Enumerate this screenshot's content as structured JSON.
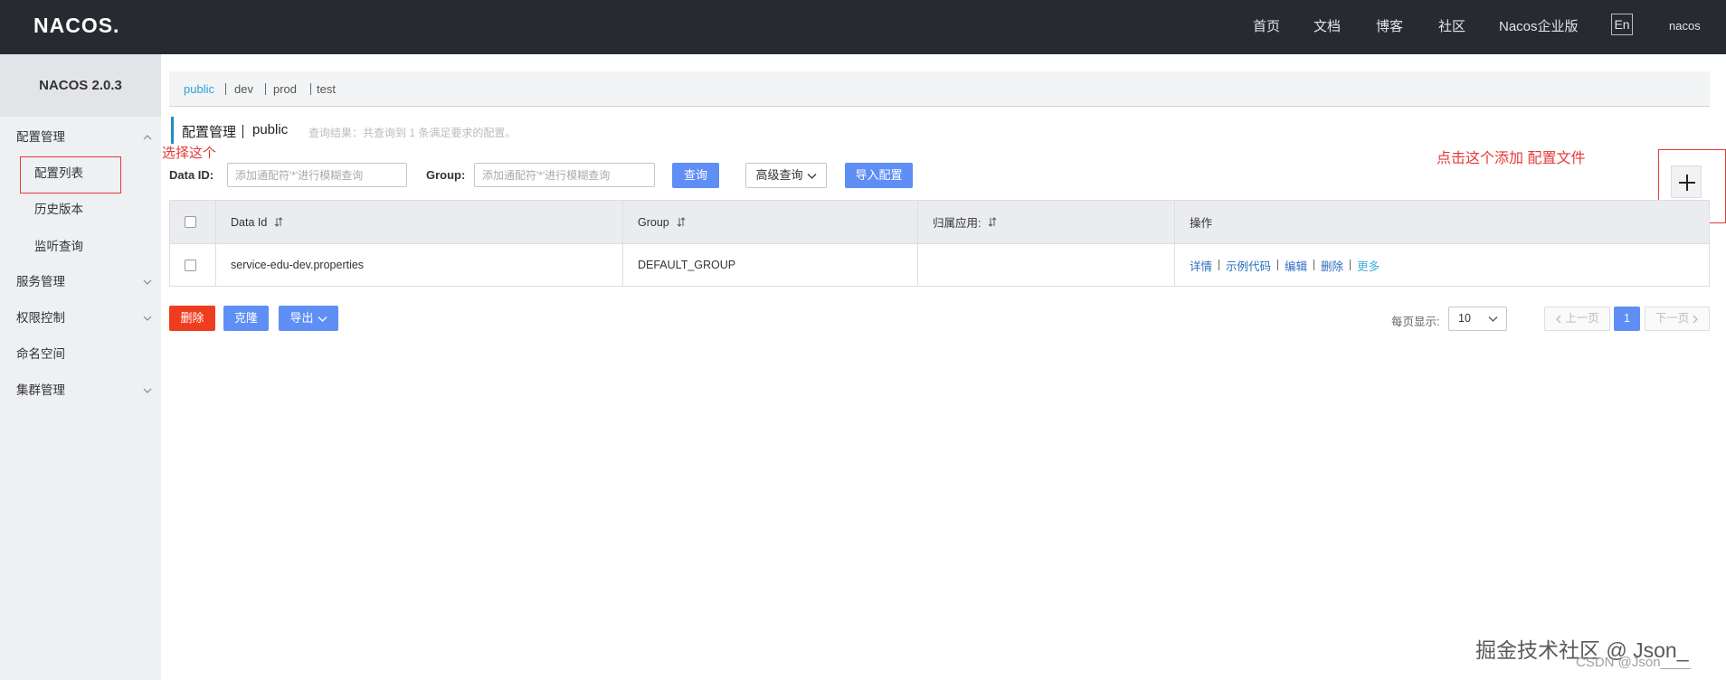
{
  "theme": {
    "accent": "#5f8ef5",
    "danger": "#f03c1e",
    "link": "#2a6ebe",
    "link_more": "#3fb0e0",
    "annotation": "#e53935",
    "namespace_active": "#2aa3d1",
    "header_bg": "#272b31"
  },
  "header": {
    "logo": "NACOS.",
    "nav": [
      {
        "label": "首页"
      },
      {
        "label": "文档"
      },
      {
        "label": "博客"
      },
      {
        "label": "社区"
      },
      {
        "label": "Nacos企业版"
      }
    ],
    "lang": "En",
    "user": "nacos"
  },
  "sidebar": {
    "version": "NACOS 2.0.3",
    "items": [
      {
        "label": "配置管理",
        "icon": "chevron-up-icon"
      },
      {
        "label": "配置列表"
      },
      {
        "label": "历史版本"
      },
      {
        "label": "监听查询"
      },
      {
        "label": "服务管理",
        "icon": "chevron-down-icon"
      },
      {
        "label": "权限控制",
        "icon": "chevron-down-icon"
      },
      {
        "label": "命名空间"
      },
      {
        "label": "集群管理",
        "icon": "chevron-down-icon"
      }
    ]
  },
  "annotations": {
    "select_hint": "选择这个",
    "add_hint": "点击这个添加 配置文件"
  },
  "namespaces": [
    {
      "label": "public"
    },
    {
      "label": "dev"
    },
    {
      "label": "prod"
    },
    {
      "label": "test"
    }
  ],
  "title": {
    "main": "配置管理",
    "namespace": "public",
    "result": "查询结果：共查询到 1 条满足要求的配置。"
  },
  "search": {
    "data_id_label": "Data ID:",
    "data_id_placeholder": "添加通配符'*'进行模糊查询",
    "group_label": "Group:",
    "group_placeholder": "添加通配符'*'进行模糊查询",
    "query": "查询",
    "advanced": "高级查询",
    "import": "导入配置"
  },
  "add_button": {
    "icon": "plus-icon"
  },
  "table": {
    "columns": [
      {
        "label": "Data Id"
      },
      {
        "label": "Group"
      },
      {
        "label": "归属应用:"
      },
      {
        "label": "操作"
      }
    ],
    "rows": [
      {
        "data_id": "service-edu-dev.properties",
        "group": "DEFAULT_GROUP",
        "app": "",
        "actions": [
          "详情",
          "示例代码",
          "编辑",
          "删除",
          "更多"
        ]
      }
    ]
  },
  "bulk": {
    "delete": "删除",
    "clone": "克隆",
    "export": "导出"
  },
  "pagination": {
    "page_size_label": "每页显示:",
    "page_size": "10",
    "prev": "上一页",
    "current": "1",
    "next": "下一页"
  },
  "watermarks": {
    "juejin": "掘金技术社区 @ Json_",
    "csdn": "CSDN @Json____"
  }
}
